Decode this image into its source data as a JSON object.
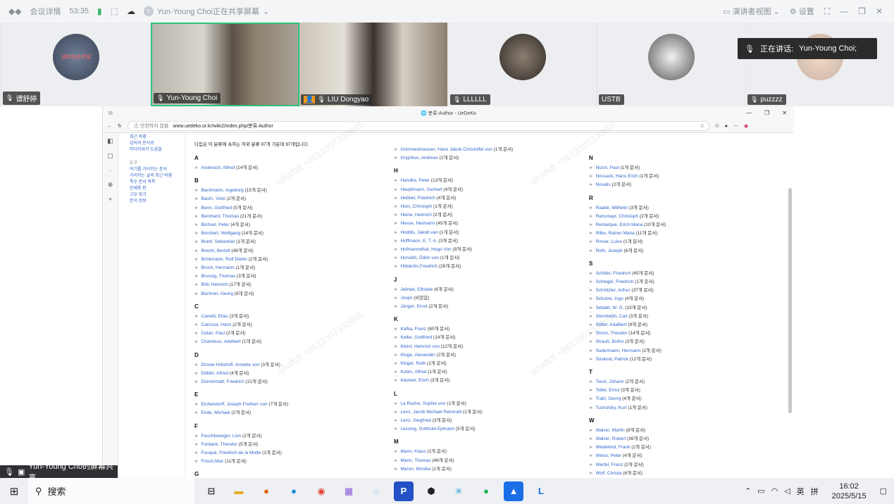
{
  "meeting": {
    "info": "会议详情",
    "timer": "53:35",
    "share_status": "Yun-Young Choi正在共享屏幕",
    "view": "演讲者视图",
    "settings": "设置"
  },
  "tiles": [
    {
      "name": "谭舒婷",
      "avatar_text": "请你在此停留"
    },
    {
      "name": "Yun-Young Choi"
    },
    {
      "name": "LIU Dongyao"
    },
    {
      "name": "LLLLLL"
    },
    {
      "name": "USTB"
    },
    {
      "name": "puzzzz"
    }
  ],
  "speaking": {
    "label": "正在讲话:",
    "name": "Yun-Young Choi;"
  },
  "browser": {
    "title": "분류:Author - UeDeKo",
    "security": "안전하지 않음",
    "url": "www.uedeko.or.kr/wiki2/index.php/분류:Author",
    "intro": "다음은 이 분류에 속하는 하위 분류 97개 가운데 97개입니다.",
    "menu": [
      "최근 바뀜",
      "임의의 문서로",
      "미디어위키 도움말"
    ],
    "tools_head": "도구",
    "tools": [
      "여기를 가리키는 문서",
      "가리키는 글의 최근 바뀜",
      "특수 문서 목록",
      "인쇄용 판",
      "고유 링크",
      "문서 정보"
    ]
  },
  "columns": [
    [
      {
        "letter": "A",
        "items": [
          [
            "Andersch, Alfred",
            "(14개 문서)"
          ]
        ]
      },
      {
        "letter": "B",
        "items": [
          [
            "Bachmann, Ingeborg",
            "(15개 문서)"
          ],
          [
            "Baum, Vicki",
            "(2개 문서)"
          ],
          [
            "Benn, Gottfried",
            "(5개 문서)"
          ],
          [
            "Bernhard, Thomas",
            "(21개 문서)"
          ],
          [
            "Bichsel, Peter",
            "(4개 문서)"
          ],
          [
            "Borchert, Wolfgang",
            "(14개 문서)"
          ],
          [
            "Brant, Sebastian",
            "(1개 문서)"
          ],
          [
            "Brecht, Bertolt",
            "(48개 문서)"
          ],
          [
            "Brinkmann, Rolf Dieter",
            "(2개 문서)"
          ],
          [
            "Broch, Hermann",
            "(1개 문서)"
          ],
          [
            "Brussig, Thomas",
            "(3개 문서)"
          ],
          [
            "Böll, Heinrich",
            "(17개 문서)"
          ],
          [
            "Büchner, Georg",
            "(6개 문서)"
          ]
        ]
      },
      {
        "letter": "C",
        "items": [
          [
            "Canetti, Elias",
            "(3개 문서)"
          ],
          [
            "Carossa, Hans",
            "(2개 문서)"
          ],
          [
            "Celan, Paul",
            "(2개 문서)"
          ],
          [
            "Chamisso, Adelbert",
            "(1개 문서)"
          ]
        ]
      },
      {
        "letter": "D",
        "items": [
          [
            "Droste-Hülshoff, Annette von",
            "(3개 문서)"
          ],
          [
            "Döblin, Alfred",
            "(4개 문서)"
          ],
          [
            "Dürrenmatt, Friedrich",
            "(21개 문서)"
          ]
        ]
      },
      {
        "letter": "E",
        "items": [
          [
            "Eichendorff, Joseph Freiherr von",
            "(7개 문서)"
          ],
          [
            "Ende, Michael",
            "(2개 문서)"
          ]
        ]
      },
      {
        "letter": "F",
        "items": [
          [
            "Feuchtwanger, Lion",
            "(2개 문서)"
          ],
          [
            "Fontane, Theodor",
            "(5개 문서)"
          ],
          [
            "Fouqué, Friedrich de la Motte",
            "(1개 문서)"
          ],
          [
            "Frisch,Max",
            "(11개 문서)"
          ]
        ]
      },
      {
        "letter": "G",
        "items": []
      }
    ],
    [
      {
        "letter": "",
        "items": [
          [
            "Grimmelshausen, Hans Jakob Christoffel von",
            "(1개 문서)"
          ],
          [
            "Gryphius, Andreas",
            "(2개 문서)"
          ]
        ]
      },
      {
        "letter": "H",
        "items": [
          [
            "Handke, Peter",
            "(13개 문서)"
          ],
          [
            "Hauptmann, Gerhart",
            "(4개 문서)"
          ],
          [
            "Hebbel, Friedrich",
            "(4개 문서)"
          ],
          [
            "Hein, Christoph",
            "(1개 문서)"
          ],
          [
            "Heine, Heinrich",
            "(2개 문서)"
          ],
          [
            "Hesse, Hermann",
            "(45개 문서)"
          ],
          [
            "Hoddis, Jakob van",
            "(1개 문서)"
          ],
          [
            "Hoffmann, E. T. A.",
            "(3개 문서)"
          ],
          [
            "Hofmannsthal, Hugo Von",
            "(9개 문서)"
          ],
          [
            "Horváth, Ödön von",
            "(1개 문서)"
          ],
          [
            "Hölderlin,Friedrich",
            "(26개 문서)"
          ]
        ]
      },
      {
        "letter": "J",
        "items": [
          [
            "Jelinek, Elfriede",
            "(6개 문서)"
          ],
          [
            "Joojin",
            "(비었음)"
          ],
          [
            "Jünger, Ernst",
            "(2개 문서)"
          ]
        ]
      },
      {
        "letter": "K",
        "items": [
          [
            "Kafka, Franz",
            "(60개 문서)"
          ],
          [
            "Keller, Gottfried",
            "(14개 문서)"
          ],
          [
            "Kleist, Heinrich von",
            "(12개 문서)"
          ],
          [
            "Kluge, Alexander",
            "(2개 문서)"
          ],
          [
            "Klüger, Ruth",
            "(1개 문서)"
          ],
          [
            "Kubin, Alfred",
            "(1개 문서)"
          ],
          [
            "Kästner, Erich",
            "(3개 문서)"
          ]
        ]
      },
      {
        "letter": "L",
        "items": [
          [
            "La Roche, Sophie von",
            "(1개 문서)"
          ],
          [
            "Lenz, Jacob Michael Reinhold",
            "(1개 문서)"
          ],
          [
            "Lenz, Siegfried",
            "(3개 문서)"
          ],
          [
            "Lessing, Gotthold Ephraim",
            "(5개 문서)"
          ]
        ]
      },
      {
        "letter": "M",
        "items": [
          [
            "Mann, Klaus",
            "(1개 문서)"
          ],
          [
            "Mann, Thomas",
            "(46개 문서)"
          ],
          [
            "Maron, Monika",
            "(1개 문서)"
          ]
        ]
      }
    ],
    [
      {
        "letter": "N",
        "items": [
          [
            "Nizon, Paul",
            "(1개 문서)"
          ],
          [
            "Nossack, Hans Erich",
            "(1개 문서)"
          ],
          [
            "Novalis",
            "(2개 문서)"
          ]
        ]
      },
      {
        "letter": "R",
        "items": [
          [
            "Raabe, Wilhelm",
            "(3개 문서)"
          ],
          [
            "Ransmayr, Christoph",
            "(2개 문서)"
          ],
          [
            "Remarque, Erich Maria",
            "(10개 문서)"
          ],
          [
            "Rilke, Rainer Maria",
            "(11개 문서)"
          ],
          [
            "Rinser, Luise",
            "(1개 문서)"
          ],
          [
            "Roth, Joseph",
            "(6개 문서)"
          ]
        ]
      },
      {
        "letter": "S",
        "items": [
          [
            "Schiller, Friedrich",
            "(45개 문서)"
          ],
          [
            "Schlegel, Friedrich",
            "(1개 문서)"
          ],
          [
            "Schnitzler, Arthur",
            "(37개 문서)"
          ],
          [
            "Schulze, Ingo",
            "(4개 문서)"
          ],
          [
            "Sebald, W. G.",
            "(15개 문서)"
          ],
          [
            "Sternheim, Carl",
            "(3개 문서)"
          ],
          [
            "Stifter, Adalbert",
            "(9개 문서)"
          ],
          [
            "Storm, Theodor",
            "(14개 문서)"
          ],
          [
            "Strauß, Botho",
            "(3개 문서)"
          ],
          [
            "Sudermann, Hermann",
            "(2개 문서)"
          ],
          [
            "Süskind, Patrick",
            "(12개 문서)"
          ]
        ]
      },
      {
        "letter": "T",
        "items": [
          [
            "Tieck, Johann",
            "(2개 문서)"
          ],
          [
            "Toller, Ernst",
            "(3개 문서)"
          ],
          [
            "Trakl, Georg",
            "(4개 문서)"
          ],
          [
            "Tucholsky, Kurt",
            "(1개 문서)"
          ]
        ]
      },
      {
        "letter": "W",
        "items": [
          [
            "Walser, Martin",
            "(8개 문서)"
          ],
          [
            "Walser, Robert",
            "(36개 문서)"
          ],
          [
            "Wedekind, Frank",
            "(2개 문서)"
          ],
          [
            "Weiss, Peter",
            "(4개 문서)"
          ],
          [
            "Werfel, Franz",
            "(2개 문서)"
          ],
          [
            "Wolf, Christa",
            "(6개 문서)"
          ]
        ]
      }
    ]
  ],
  "presenter": "Yun-Young Cho的屏幕共享",
  "watermark": "ojhaftdt +8613307330695",
  "taskbar": {
    "search": "搜索",
    "ime": "英",
    "ime2": "拼",
    "time": "16:02",
    "date": "2025/5/15"
  },
  "colors": {
    "accent": "#2fc27b",
    "link": "#3366cc"
  }
}
